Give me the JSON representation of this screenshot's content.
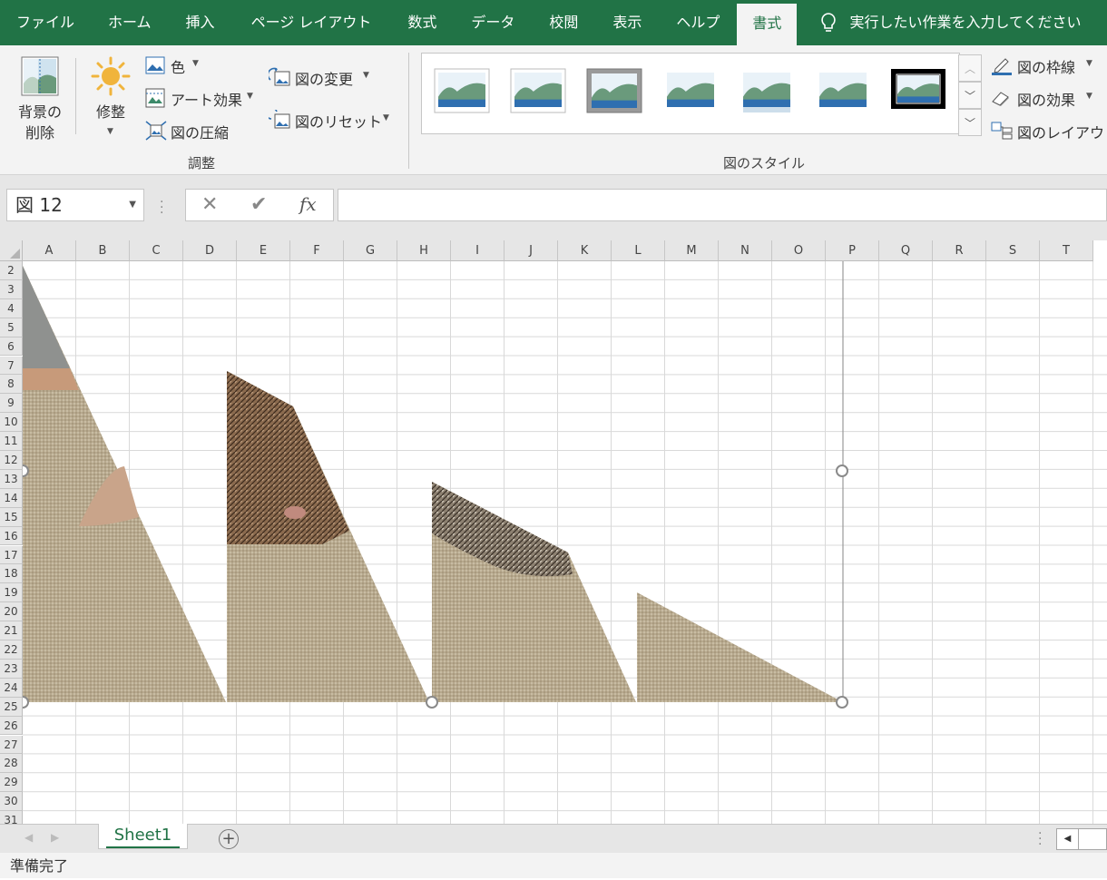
{
  "tabs": [
    {
      "label": "ファイル",
      "active": false
    },
    {
      "label": "ホーム",
      "active": false
    },
    {
      "label": "挿入",
      "active": false
    },
    {
      "label": "ページ レイアウト",
      "active": false
    },
    {
      "label": "数式",
      "active": false
    },
    {
      "label": "データ",
      "active": false
    },
    {
      "label": "校閲",
      "active": false
    },
    {
      "label": "表示",
      "active": false
    },
    {
      "label": "ヘルプ",
      "active": false
    },
    {
      "label": "書式",
      "active": true
    }
  ],
  "tell_me": "実行したい作業を入力してください",
  "ribbon": {
    "remove_bg_line1": "背景の",
    "remove_bg_line2": "削除",
    "corrections": "修整",
    "color": "色",
    "art_effects": "アート効果",
    "compress": "図の圧縮",
    "change_picture": "図の変更",
    "reset_picture": "図のリセット",
    "group_adjust": "調整",
    "group_styles": "図のスタイル",
    "picture_border": "図の枠線",
    "picture_effects": "図の効果",
    "picture_layout": "図のレイアウト"
  },
  "name_box": "図 12",
  "formula_value": "",
  "columns": [
    "A",
    "B",
    "C",
    "D",
    "E",
    "F",
    "G",
    "H",
    "I",
    "J",
    "K",
    "L",
    "M",
    "N",
    "O",
    "P",
    "Q",
    "R",
    "S",
    "T"
  ],
  "rows": [
    "2",
    "3",
    "4",
    "5",
    "6",
    "7",
    "8",
    "9",
    "10",
    "11",
    "12",
    "13",
    "14",
    "15",
    "16",
    "17",
    "18",
    "19",
    "20",
    "21",
    "22",
    "23",
    "24",
    "25",
    "26",
    "27",
    "28",
    "29",
    "30",
    "31"
  ],
  "sheet_tab": "Sheet1",
  "status": "準備完了",
  "colors": {
    "accent": "#217346",
    "ribbon_bg": "#f3f3f3",
    "grid_line": "#d9d9d9"
  }
}
